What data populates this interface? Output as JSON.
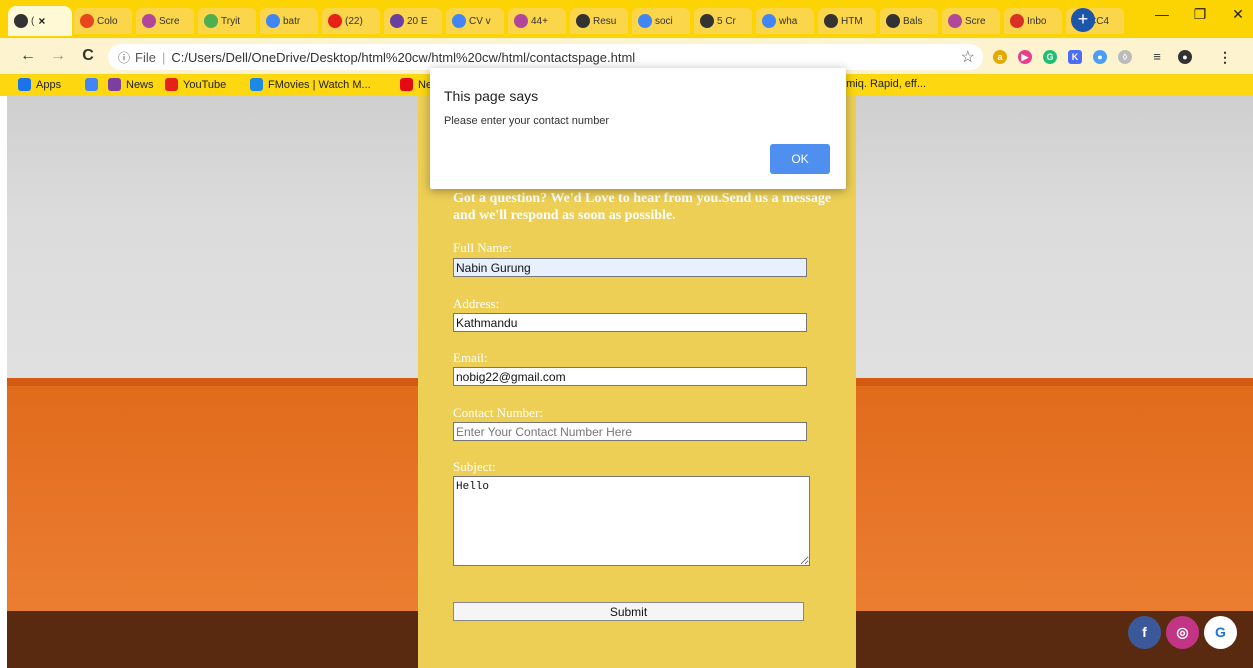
{
  "browser": {
    "tabs": [
      {
        "label": "( ",
        "color": "#333333",
        "active": true
      },
      {
        "label": "Colo",
        "color": "#e8451e"
      },
      {
        "label": "Scre",
        "color": "#b0479a"
      },
      {
        "label": "Tryit",
        "color": "#4caf50"
      },
      {
        "label": "batr",
        "color": "#4285f4"
      },
      {
        "label": "(22)",
        "color": "#e62117"
      },
      {
        "label": "20 E",
        "color": "#6b3fa0"
      },
      {
        "label": "CV v",
        "color": "#4285f4"
      },
      {
        "label": "44+",
        "color": "#b0479a"
      },
      {
        "label": "Resu",
        "color": "#333333"
      },
      {
        "label": "soci",
        "color": "#4285f4"
      },
      {
        "label": "5 Cr",
        "color": "#333333"
      },
      {
        "label": "wha",
        "color": "#4285f4"
      },
      {
        "label": "HTM",
        "color": "#333333"
      },
      {
        "label": "Bals",
        "color": "#333333"
      },
      {
        "label": "Scre",
        "color": "#b0479a"
      },
      {
        "label": "Inbo",
        "color": "#d93025"
      },
      {
        "label": "CC4",
        "color": "#1a73e8"
      }
    ],
    "address": {
      "scheme": "File",
      "url": "C:/Users/Dell/OneDrive/Desktop/html%20cw/html%20cw/html/contactspage.html"
    },
    "bookmarks": [
      {
        "label": "Apps",
        "color": "#1a73e8"
      },
      {
        "label": "",
        "color": "#4285f4"
      },
      {
        "label": "News",
        "color": "#7b3fa0"
      },
      {
        "label": "YouTube",
        "color": "#e62117"
      },
      {
        "label": "FMovies | Watch M...",
        "color": "#1e88e5"
      },
      {
        "label": "Ne",
        "color": "#e50914"
      },
      {
        "label": "amiq. Rapid, eff...",
        "color": ""
      }
    ]
  },
  "dialog": {
    "title": "This page says",
    "message": "Please enter your contact number",
    "ok_label": "OK"
  },
  "form": {
    "intro": "Got a question? We'd Love to hear from you.Send us a message and we'll respond as soon as possible.",
    "full_name_label": "Full Name:",
    "full_name_value": "Nabin Gurung",
    "address_label": "Address:",
    "address_value": "Kathmandu",
    "email_label": "Email:",
    "email_value": "nobig22@gmail.com",
    "contact_label": "Contact Number:",
    "contact_placeholder": "Enter Your Contact Number Here",
    "subject_label": "Subject:",
    "subject_value": "Hello",
    "submit_label": "Submit"
  },
  "social": [
    {
      "name": "facebook",
      "glyph": "f",
      "color": "#3b5998"
    },
    {
      "name": "instagram",
      "glyph": "◎",
      "color": "#c13584"
    },
    {
      "name": "google",
      "glyph": "G",
      "color": "#ffffff"
    }
  ]
}
